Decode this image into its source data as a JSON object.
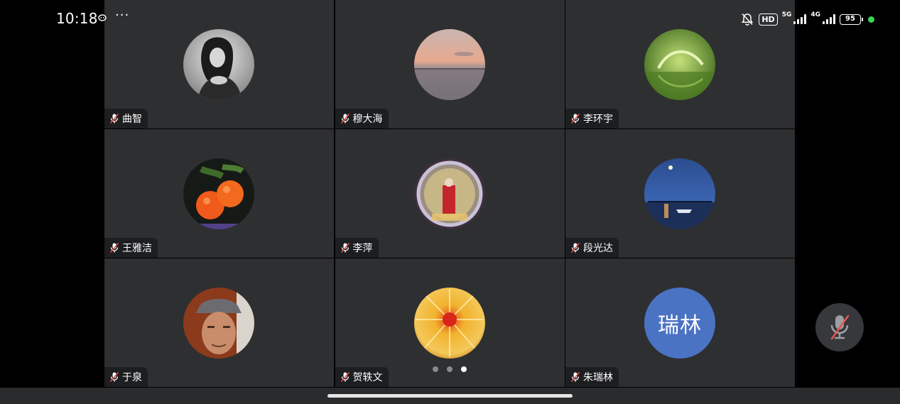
{
  "status_bar": {
    "time": "10:18",
    "more": "···",
    "hd": "HD",
    "net_5g": "5G",
    "net_4g": "4G",
    "battery": "95",
    "icons": [
      "wechat-icon",
      "bell-off-icon",
      "signal-icon",
      "battery-icon"
    ]
  },
  "meeting": {
    "participants": [
      {
        "name": "曲智",
        "muted": true,
        "avatar": "photo-woman"
      },
      {
        "name": "穆大海",
        "muted": true,
        "avatar": "photo-sunset-sea"
      },
      {
        "name": "李环宇",
        "muted": true,
        "avatar": "photo-leaf-droplet"
      },
      {
        "name": "王雅洁",
        "muted": true,
        "avatar": "photo-oranges"
      },
      {
        "name": "李萍",
        "muted": true,
        "avatar": "photo-portrait-frame"
      },
      {
        "name": "段光达",
        "muted": true,
        "avatar": "photo-night-harbor"
      },
      {
        "name": "于泉",
        "muted": true,
        "avatar": "photo-man-cap"
      },
      {
        "name": "贺轶文",
        "muted": true,
        "avatar": "photo-chrysanthemum"
      },
      {
        "name": "朱瑞林",
        "muted": true,
        "avatar_text": "瑞林",
        "avatar_color": "#4b73c4"
      }
    ],
    "pagination": {
      "pages": 3,
      "current": 3
    }
  },
  "controls": {
    "microphone": "muted"
  }
}
